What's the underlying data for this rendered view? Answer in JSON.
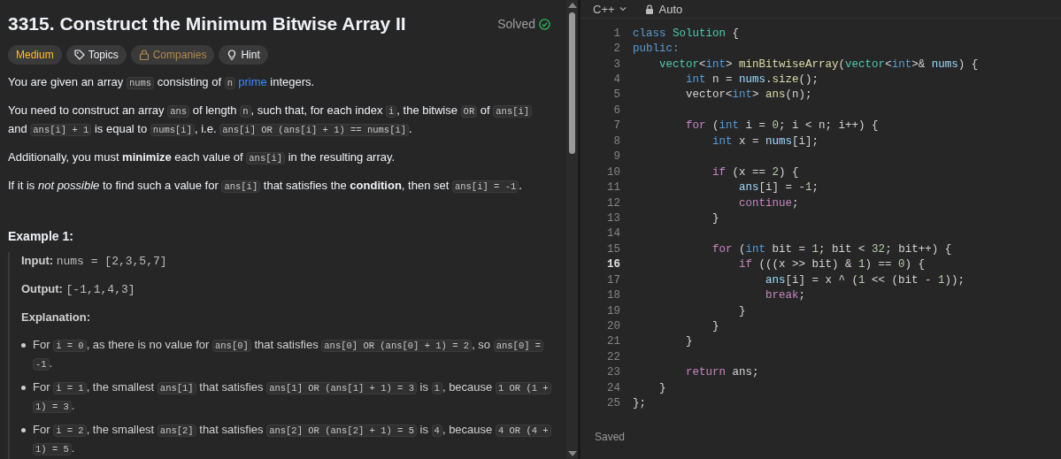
{
  "problem": {
    "title": "3315. Construct the Minimum Bitwise Array II",
    "status": "Solved",
    "tags": [
      {
        "kind": "difficulty",
        "label": "Medium"
      },
      {
        "kind": "topics",
        "label": "Topics"
      },
      {
        "kind": "companies",
        "label": "Companies"
      },
      {
        "kind": "hint",
        "label": "Hint"
      }
    ],
    "paragraphs": [
      [
        {
          "kind": "text",
          "text": "You are given an array "
        },
        {
          "kind": "code",
          "text": "nums"
        },
        {
          "kind": "text",
          "text": " consisting of "
        },
        {
          "kind": "code",
          "text": "n"
        },
        {
          "kind": "link",
          "text": "prime"
        },
        {
          "kind": "text",
          "text": " integers."
        }
      ],
      [
        {
          "kind": "text",
          "text": "You need to construct an array "
        },
        {
          "kind": "code",
          "text": "ans"
        },
        {
          "kind": "text",
          "text": " of length "
        },
        {
          "kind": "code",
          "text": "n"
        },
        {
          "kind": "text",
          "text": ", such that, for each index "
        },
        {
          "kind": "code",
          "text": "i"
        },
        {
          "kind": "text",
          "text": ", the bitwise "
        },
        {
          "kind": "code",
          "text": "OR"
        },
        {
          "kind": "text",
          "text": " of "
        },
        {
          "kind": "code",
          "text": "ans[i]"
        },
        {
          "kind": "text",
          "text": " and "
        },
        {
          "kind": "code",
          "text": "ans[i] + 1"
        },
        {
          "kind": "text",
          "text": " is equal to "
        },
        {
          "kind": "code",
          "text": "nums[i]"
        },
        {
          "kind": "text",
          "text": ", i.e. "
        },
        {
          "kind": "code",
          "text": "ans[i] OR (ans[i] + 1) == nums[i]"
        },
        {
          "kind": "text",
          "text": "."
        }
      ],
      [
        {
          "kind": "text",
          "text": "Additionally, you must **minimize** each value of "
        },
        {
          "kind": "code",
          "text": "ans[i]"
        },
        {
          "kind": "text",
          "text": " in the resulting array."
        }
      ],
      [
        {
          "kind": "text",
          "text": "If it is *not possible* to find such a value for "
        },
        {
          "kind": "code",
          "text": "ans[i]"
        },
        {
          "kind": "text",
          "text": " that satisfies the **condition**, then set "
        },
        {
          "kind": "code",
          "text": "ans[i] = -1"
        },
        {
          "kind": "text",
          "text": "."
        }
      ]
    ],
    "example": {
      "heading": "Example 1:",
      "input_label": "Input:",
      "input": "nums = [2,3,5,7]",
      "output_label": "Output:",
      "output": "[-1,1,4,3]",
      "explanation_label": "Explanation:",
      "bullets": [
        [
          {
            "kind": "text",
            "text": "For "
          },
          {
            "kind": "code",
            "text": "i = 0"
          },
          {
            "kind": "text",
            "text": ", as there is no value for "
          },
          {
            "kind": "code",
            "text": "ans[0]"
          },
          {
            "kind": "text",
            "text": " that satisfies "
          },
          {
            "kind": "code",
            "text": "ans[0] OR (ans[0] + 1) = 2"
          },
          {
            "kind": "text",
            "text": ", so "
          },
          {
            "kind": "code",
            "text": "ans[0] = -1"
          },
          {
            "kind": "text",
            "text": "."
          }
        ],
        [
          {
            "kind": "text",
            "text": "For "
          },
          {
            "kind": "code",
            "text": "i = 1"
          },
          {
            "kind": "text",
            "text": ", the smallest "
          },
          {
            "kind": "code",
            "text": "ans[1]"
          },
          {
            "kind": "text",
            "text": " that satisfies "
          },
          {
            "kind": "code",
            "text": "ans[1] OR (ans[1] + 1) = 3"
          },
          {
            "kind": "text",
            "text": " is "
          },
          {
            "kind": "code",
            "text": "1"
          },
          {
            "kind": "text",
            "text": ", because "
          },
          {
            "kind": "code",
            "text": "1 OR (1 + 1) = 3"
          },
          {
            "kind": "text",
            "text": "."
          }
        ],
        [
          {
            "kind": "text",
            "text": "For "
          },
          {
            "kind": "code",
            "text": "i = 2"
          },
          {
            "kind": "text",
            "text": ", the smallest "
          },
          {
            "kind": "code",
            "text": "ans[2]"
          },
          {
            "kind": "text",
            "text": " that satisfies "
          },
          {
            "kind": "code",
            "text": "ans[2] OR (ans[2] + 1) = 5"
          },
          {
            "kind": "text",
            "text": " is "
          },
          {
            "kind": "code",
            "text": "4"
          },
          {
            "kind": "text",
            "text": ", because "
          },
          {
            "kind": "code",
            "text": "4 OR (4 + 1) = 5"
          },
          {
            "kind": "text",
            "text": "."
          }
        ]
      ]
    }
  },
  "editor": {
    "language": "C++",
    "mode": "Auto",
    "status": "Saved",
    "lines": [
      {
        "number": "1",
        "active": false,
        "tokens": [
          {
            "kind": "keyword",
            "text": "class "
          },
          {
            "kind": "type",
            "text": "Solution"
          },
          {
            "kind": "plain",
            "text": " {"
          }
        ]
      },
      {
        "number": "2",
        "active": false,
        "tokens": [
          {
            "kind": "keyword",
            "text": "public:"
          }
        ]
      },
      {
        "number": "3",
        "active": false,
        "tokens": [
          {
            "kind": "type",
            "text": "    vector"
          },
          {
            "kind": "plain",
            "text": "<"
          },
          {
            "kind": "keyword",
            "text": "int"
          },
          {
            "kind": "plain",
            "text": "> "
          },
          {
            "kind": "function",
            "text": "minBitwiseArray"
          },
          {
            "kind": "plain",
            "text": "("
          },
          {
            "kind": "type",
            "text": "vector"
          },
          {
            "kind": "plain",
            "text": "<"
          },
          {
            "kind": "keyword",
            "text": "int"
          },
          {
            "kind": "plain",
            "text": ">& "
          },
          {
            "kind": "variable",
            "text": "nums"
          },
          {
            "kind": "plain",
            "text": ") {"
          }
        ]
      },
      {
        "number": "4",
        "active": false,
        "tokens": [
          {
            "kind": "keyword",
            "text": "        int"
          },
          {
            "kind": "plain",
            "text": " n = "
          },
          {
            "kind": "variable",
            "text": "nums"
          },
          {
            "kind": "plain",
            "text": "."
          },
          {
            "kind": "function",
            "text": "size"
          },
          {
            "kind": "plain",
            "text": "();"
          }
        ]
      },
      {
        "number": "5",
        "active": false,
        "tokens": [
          {
            "kind": "plain",
            "text": "        vector<"
          },
          {
            "kind": "keyword",
            "text": "int"
          },
          {
            "kind": "plain",
            "text": "> "
          },
          {
            "kind": "function",
            "text": "ans"
          },
          {
            "kind": "plain",
            "text": "(n);"
          }
        ]
      },
      {
        "number": "6",
        "active": false
      },
      {
        "number": "7",
        "active": false,
        "tokens": [
          {
            "kind": "control",
            "text": "        for"
          },
          {
            "kind": "plain",
            "text": " ("
          },
          {
            "kind": "keyword",
            "text": "int"
          },
          {
            "kind": "plain",
            "text": " i = "
          },
          {
            "kind": "number",
            "text": "0"
          },
          {
            "kind": "plain",
            "text": "; i < n; i++) {"
          }
        ]
      },
      {
        "number": "8",
        "active": false,
        "tokens": [
          {
            "kind": "keyword",
            "text": "            int"
          },
          {
            "kind": "plain",
            "text": " x = "
          },
          {
            "kind": "variable",
            "text": "nums"
          },
          {
            "kind": "plain",
            "text": "[i];"
          }
        ]
      },
      {
        "number": "9",
        "active": false
      },
      {
        "number": "10",
        "active": false,
        "tokens": [
          {
            "kind": "control",
            "text": "            if"
          },
          {
            "kind": "plain",
            "text": " (x == "
          },
          {
            "kind": "number",
            "text": "2"
          },
          {
            "kind": "plain",
            "text": ") {"
          }
        ]
      },
      {
        "number": "11",
        "active": false,
        "tokens": [
          {
            "kind": "variable",
            "text": "                ans"
          },
          {
            "kind": "plain",
            "text": "[i] = -"
          },
          {
            "kind": "number",
            "text": "1"
          },
          {
            "kind": "plain",
            "text": ";"
          }
        ]
      },
      {
        "number": "12",
        "active": false,
        "tokens": [
          {
            "kind": "control",
            "text": "                continue"
          },
          {
            "kind": "plain",
            "text": ";"
          }
        ]
      },
      {
        "number": "13",
        "active": false,
        "tokens": [
          {
            "kind": "plain",
            "text": "            }"
          }
        ]
      },
      {
        "number": "14",
        "active": false
      },
      {
        "number": "15",
        "active": false,
        "tokens": [
          {
            "kind": "control",
            "text": "            for"
          },
          {
            "kind": "plain",
            "text": " ("
          },
          {
            "kind": "keyword",
            "text": "int"
          },
          {
            "kind": "plain",
            "text": " bit = "
          },
          {
            "kind": "number",
            "text": "1"
          },
          {
            "kind": "plain",
            "text": "; bit < "
          },
          {
            "kind": "number",
            "text": "32"
          },
          {
            "kind": "plain",
            "text": "; bit++) {"
          }
        ]
      },
      {
        "number": "16",
        "active": true,
        "tokens": [
          {
            "kind": "control",
            "text": "                if"
          },
          {
            "kind": "plain",
            "text": " (((x >> bit) & "
          },
          {
            "kind": "number",
            "text": "1"
          },
          {
            "kind": "plain",
            "text": ") == "
          },
          {
            "kind": "number",
            "text": "0"
          },
          {
            "kind": "plain",
            "text": ") {"
          }
        ]
      },
      {
        "number": "17",
        "active": false,
        "tokens": [
          {
            "kind": "variable",
            "text": "                    ans"
          },
          {
            "kind": "plain",
            "text": "[i] = x ^ ("
          },
          {
            "kind": "number",
            "text": "1"
          },
          {
            "kind": "plain",
            "text": " << (bit - "
          },
          {
            "kind": "number",
            "text": "1"
          },
          {
            "kind": "plain",
            "text": "));"
          }
        ]
      },
      {
        "number": "18",
        "active": false,
        "tokens": [
          {
            "kind": "control",
            "text": "                    break"
          },
          {
            "kind": "plain",
            "text": ";"
          }
        ]
      },
      {
        "number": "19",
        "active": false,
        "tokens": [
          {
            "kind": "plain",
            "text": "                }"
          }
        ]
      },
      {
        "number": "20",
        "active": false,
        "tokens": [
          {
            "kind": "plain",
            "text": "            }"
          }
        ]
      },
      {
        "number": "21",
        "active": false,
        "tokens": [
          {
            "kind": "plain",
            "text": "        }"
          }
        ]
      },
      {
        "number": "22",
        "active": false
      },
      {
        "number": "23",
        "active": false,
        "tokens": [
          {
            "kind": "control",
            "text": "        return"
          },
          {
            "kind": "plain",
            "text": " ans;"
          }
        ]
      },
      {
        "number": "24",
        "active": false,
        "tokens": [
          {
            "kind": "plain",
            "text": "    }"
          }
        ]
      },
      {
        "number": "25",
        "active": false,
        "tokens": [
          {
            "kind": "plain",
            "text": "};"
          }
        ]
      }
    ]
  }
}
